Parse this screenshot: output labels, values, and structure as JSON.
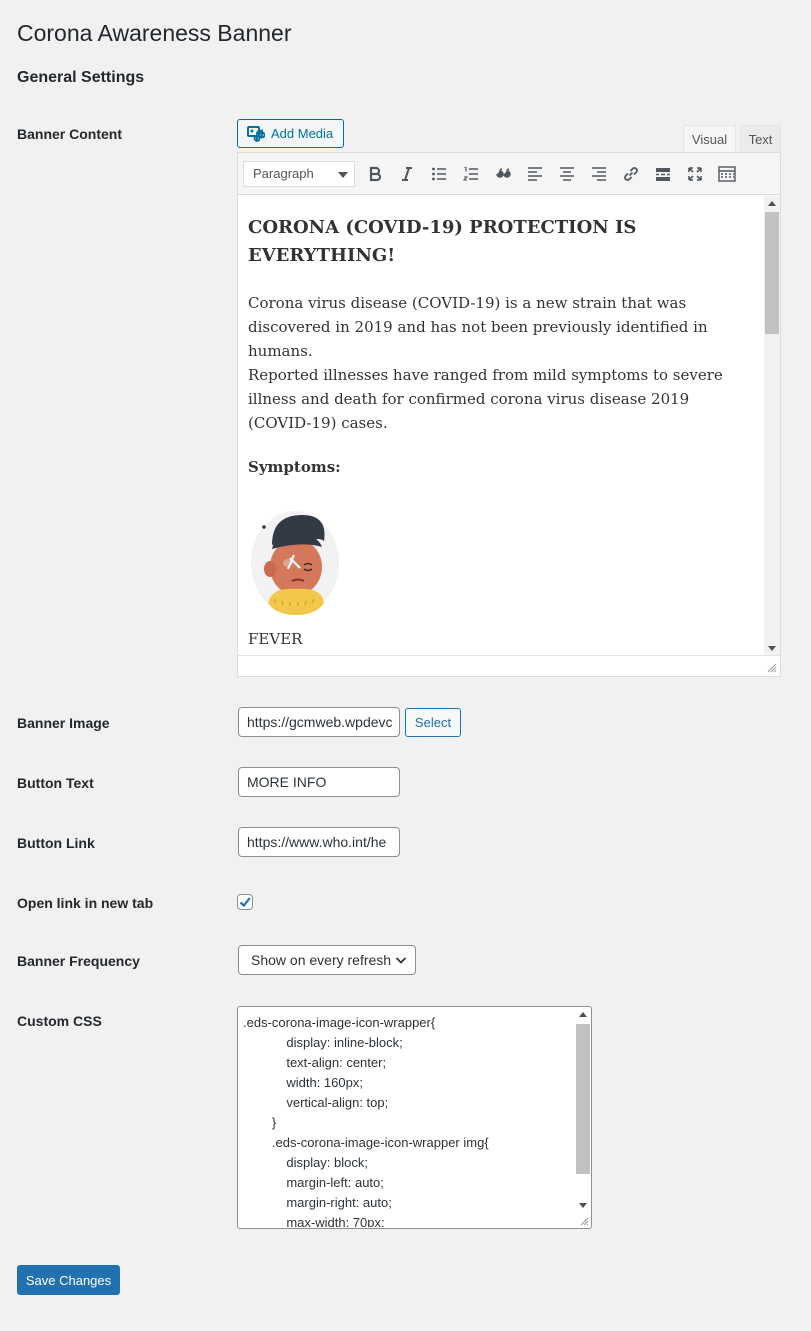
{
  "page": {
    "title": "Corona Awareness Banner",
    "section_title": "General Settings"
  },
  "labels": {
    "banner_content": "Banner Content",
    "banner_image": "Banner Image",
    "button_text": "Button Text",
    "button_link": "Button Link",
    "open_new_tab": "Open link in new tab",
    "banner_frequency": "Banner Frequency",
    "custom_css": "Custom CSS"
  },
  "editor": {
    "add_media_label": "Add Media",
    "tabs": {
      "visual": "Visual",
      "text": "Text"
    },
    "active_tab": "Visual",
    "format_select": "Paragraph",
    "toolbar_icons": [
      "bold-icon",
      "italic-icon",
      "bulleted-list-icon",
      "numbered-list-icon",
      "blockquote-icon",
      "align-left-icon",
      "align-center-icon",
      "align-right-icon",
      "link-icon",
      "read-more-icon",
      "fullscreen-icon",
      "toolbar-toggle-icon"
    ],
    "content": {
      "heading": "CORONA (COVID-19) PROTECTION IS EVERYTHING!",
      "line1": "Corona virus disease (COVID-19) is a new strain that was discovered in 2019 and has not been previously identified in humans.",
      "line2": "Reported illnesses have ranged from mild symptoms to severe illness and death for confirmed corona virus disease 2019 (COVID-19) cases.",
      "symptoms": "Symptoms:",
      "fever": "FEVER"
    }
  },
  "fields": {
    "banner_image_value": "https://gcmweb.wpdevc",
    "select_button": "Select",
    "button_text_value": "MORE INFO",
    "button_link_value": "https://www.who.int/he",
    "open_new_tab_checked": true,
    "banner_frequency_value": "Show on every refresh",
    "custom_css_lines": [
      ".eds-corona-image-icon-wrapper{",
      "            display: inline-block;",
      "            text-align: center;",
      "            width: 160px;",
      "            vertical-align: top;",
      "        }",
      "        .eds-corona-image-icon-wrapper img{",
      "            display: block;",
      "            margin-left: auto;",
      "            margin-right: auto;",
      "            max-width: 70px;"
    ]
  },
  "save_button": "Save Changes",
  "colors": {
    "background": "#f1f1f1",
    "primary": "#2271b1",
    "text": "#23282d"
  }
}
